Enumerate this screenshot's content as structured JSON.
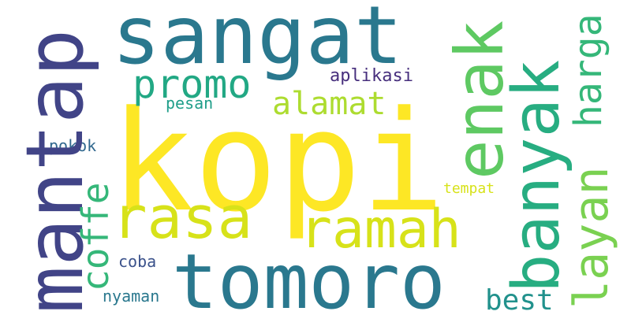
{
  "words": [
    {
      "text": "kopi",
      "color": "#fde725"
    },
    {
      "text": "sangat",
      "color": "#2a788e"
    },
    {
      "text": "mantap",
      "color": "#414487"
    },
    {
      "text": "tomoro",
      "color": "#2a788e"
    },
    {
      "text": "banyak",
      "color": "#27ad81"
    },
    {
      "text": "enak",
      "color": "#5ec962"
    },
    {
      "text": "ramah",
      "color": "#d7e219"
    },
    {
      "text": "rasa",
      "color": "#d7e219"
    },
    {
      "text": "promo",
      "color": "#22a884"
    },
    {
      "text": "alamat",
      "color": "#addc30"
    },
    {
      "text": "harga",
      "color": "#35b779"
    },
    {
      "text": "layan",
      "color": "#7ad151"
    },
    {
      "text": "coffe",
      "color": "#35b779"
    },
    {
      "text": "best",
      "color": "#21918c"
    },
    {
      "text": "aplikasi",
      "color": "#472f7d"
    },
    {
      "text": "pesan",
      "color": "#1f9e89"
    },
    {
      "text": "pokok",
      "color": "#31688e"
    },
    {
      "text": "tempat",
      "color": "#d7e219"
    },
    {
      "text": "coba",
      "color": "#3b528b"
    },
    {
      "text": "nyaman",
      "color": "#2a788e"
    }
  ]
}
